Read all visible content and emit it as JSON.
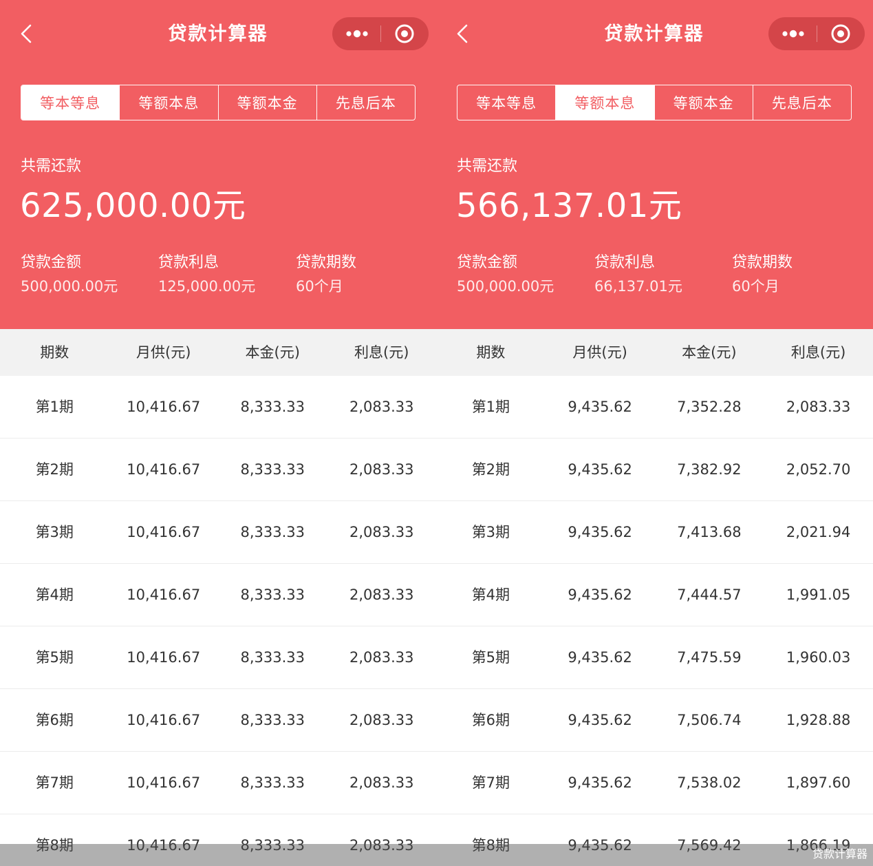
{
  "watermark": "贷款计算器",
  "accent_color": "#f25e62",
  "icons": {
    "back": "chevron-left-icon",
    "more": "more-dots-icon",
    "close": "target-close-icon"
  },
  "panels": [
    {
      "title": "贷款计算器",
      "tabs": [
        {
          "label": "等本等息",
          "active": true
        },
        {
          "label": "等额本息",
          "active": false
        },
        {
          "label": "等额本金",
          "active": false
        },
        {
          "label": "先息后本",
          "active": false
        }
      ],
      "total_label": "共需还款",
      "total_amount": "625,000.00元",
      "stats": [
        {
          "label": "贷款金额",
          "value": "500,000.00元"
        },
        {
          "label": "贷款利息",
          "value": "125,000.00元"
        },
        {
          "label": "贷款期数",
          "value": "60个月"
        }
      ],
      "columns": [
        "期数",
        "月供(元)",
        "本金(元)",
        "利息(元)"
      ],
      "rows": [
        [
          "第1期",
          "10,416.67",
          "8,333.33",
          "2,083.33"
        ],
        [
          "第2期",
          "10,416.67",
          "8,333.33",
          "2,083.33"
        ],
        [
          "第3期",
          "10,416.67",
          "8,333.33",
          "2,083.33"
        ],
        [
          "第4期",
          "10,416.67",
          "8,333.33",
          "2,083.33"
        ],
        [
          "第5期",
          "10,416.67",
          "8,333.33",
          "2,083.33"
        ],
        [
          "第6期",
          "10,416.67",
          "8,333.33",
          "2,083.33"
        ],
        [
          "第7期",
          "10,416.67",
          "8,333.33",
          "2,083.33"
        ],
        [
          "第8期",
          "10,416.67",
          "8,333.33",
          "2,083.33"
        ]
      ]
    },
    {
      "title": "贷款计算器",
      "tabs": [
        {
          "label": "等本等息",
          "active": false
        },
        {
          "label": "等额本息",
          "active": true
        },
        {
          "label": "等额本金",
          "active": false
        },
        {
          "label": "先息后本",
          "active": false
        }
      ],
      "total_label": "共需还款",
      "total_amount": "566,137.01元",
      "stats": [
        {
          "label": "贷款金额",
          "value": "500,000.00元"
        },
        {
          "label": "贷款利息",
          "value": "66,137.01元"
        },
        {
          "label": "贷款期数",
          "value": "60个月"
        }
      ],
      "columns": [
        "期数",
        "月供(元)",
        "本金(元)",
        "利息(元)"
      ],
      "rows": [
        [
          "第1期",
          "9,435.62",
          "7,352.28",
          "2,083.33"
        ],
        [
          "第2期",
          "9,435.62",
          "7,382.92",
          "2,052.70"
        ],
        [
          "第3期",
          "9,435.62",
          "7,413.68",
          "2,021.94"
        ],
        [
          "第4期",
          "9,435.62",
          "7,444.57",
          "1,991.05"
        ],
        [
          "第5期",
          "9,435.62",
          "7,475.59",
          "1,960.03"
        ],
        [
          "第6期",
          "9,435.62",
          "7,506.74",
          "1,928.88"
        ],
        [
          "第7期",
          "9,435.62",
          "7,538.02",
          "1,897.60"
        ],
        [
          "第8期",
          "9,435.62",
          "7,569.42",
          "1,866.19"
        ]
      ]
    }
  ]
}
